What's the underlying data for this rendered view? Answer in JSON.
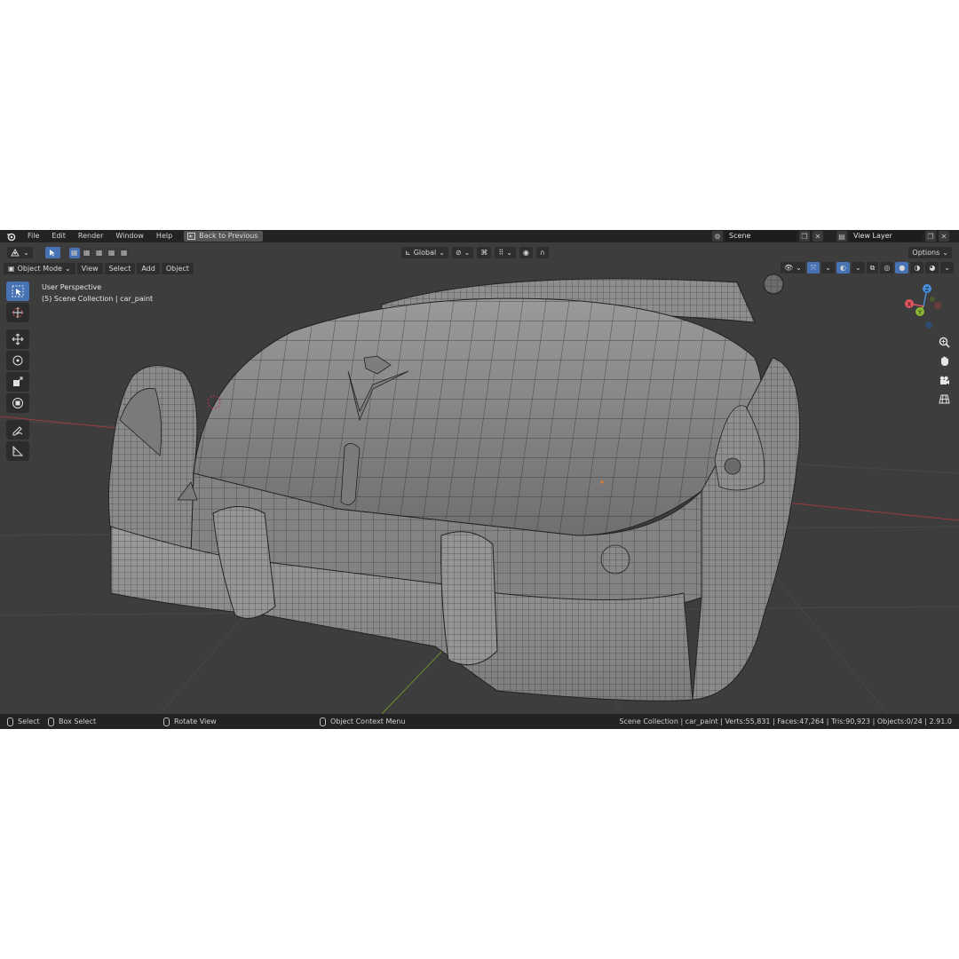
{
  "menu": {
    "items": [
      "File",
      "Edit",
      "Render",
      "Window",
      "Help"
    ],
    "back_label": "Back to Previous"
  },
  "scene": {
    "name": "Scene"
  },
  "view_layer": {
    "name": "View Layer"
  },
  "header": {
    "transform_orientation": "Global",
    "options_label": "Options"
  },
  "header2": {
    "mode": "Object Mode",
    "view": "View",
    "select": "Select",
    "add": "Add",
    "object": "Object"
  },
  "viewport": {
    "perspective": "User Perspective",
    "collection": "(5) Scene Collection | car_paint"
  },
  "gizmo": {
    "x": "X",
    "y": "Y",
    "z": "Z"
  },
  "status": {
    "select": "Select",
    "box_select": "Box Select",
    "rotate_view": "Rotate View",
    "context_menu": "Object Context Menu",
    "stats": "Scene Collection | car_paint | Verts:55,831 | Faces:47,264 | Tris:90,923 | Objects:0/24 | 2.91.0"
  },
  "colors": {
    "accent": "#4772b3",
    "background": "#3d3d3d",
    "header": "#232323",
    "x_axis": "#e05560",
    "y_axis": "#8ab633",
    "z_axis": "#4a8fd9"
  }
}
